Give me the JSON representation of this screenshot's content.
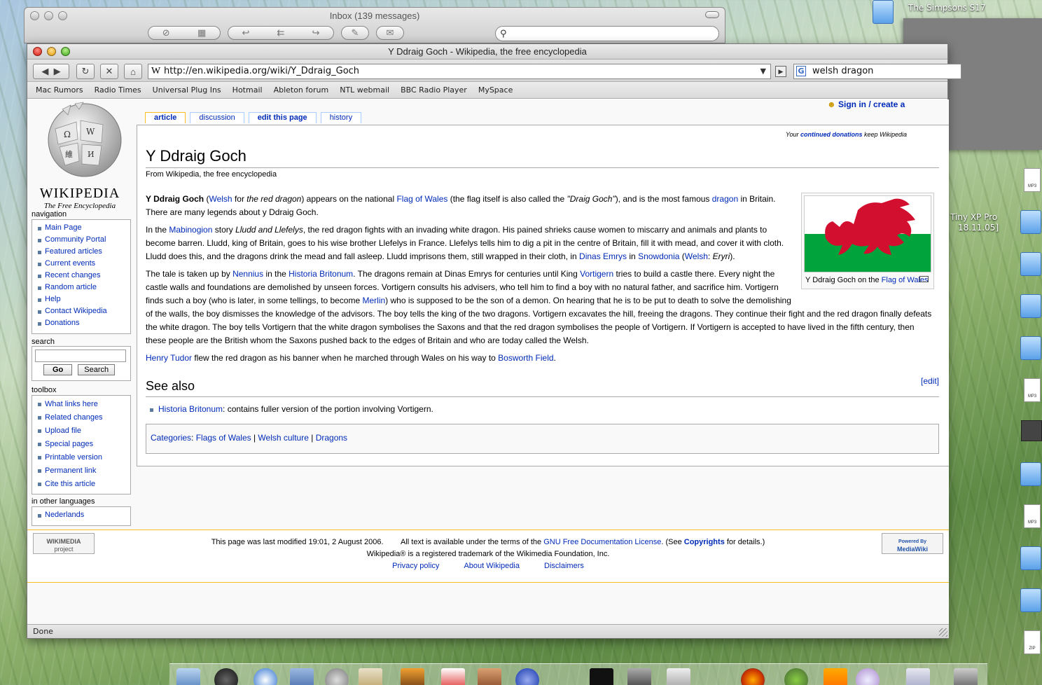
{
  "mail": {
    "title": "Inbox (139 messages)"
  },
  "browser": {
    "title": "Y Ddraig Goch - Wikipedia, the free encyclopedia",
    "url": "http://en.wikipedia.org/wiki/Y_Ddraig_Goch",
    "search_value": "welsh dragon",
    "bookmarks": [
      "Mac Rumors",
      "Radio Times",
      "Universal Plug Ins",
      "Hotmail",
      "Ableton forum",
      "NTL webmail",
      "BBC Radio Player",
      "MySpace"
    ],
    "status": "Done"
  },
  "wiki": {
    "logo_title": "WIKIPEDIA",
    "logo_subtitle": "The Free Encyclopedia",
    "personal": "Sign in / create a",
    "tabs": [
      "article",
      "discussion",
      "edit this page",
      "history"
    ],
    "navigation_label": "navigation",
    "navigation": [
      "Main Page",
      "Community Portal",
      "Featured articles",
      "Current events",
      "Recent changes",
      "Random article",
      "Help",
      "Contact Wikipedia",
      "Donations"
    ],
    "search_label": "search",
    "search_go": "Go",
    "search_btn": "Search",
    "toolbox_label": "toolbox",
    "toolbox": [
      "What links here",
      "Related changes",
      "Upload file",
      "Special pages",
      "Printable version",
      "Permanent link",
      "Cite this article"
    ],
    "languages_label": "in other languages",
    "languages": [
      "Nederlands"
    ],
    "donate_pre": "Your ",
    "donate_link": "continued donations",
    "donate_post": " keep Wikipedia",
    "title": "Y Ddraig Goch",
    "from": "From Wikipedia, the free encyclopedia",
    "thumb_caption_pre": "Y Ddraig Goch on the ",
    "thumb_caption_link": "Flag of Wales",
    "edit": "[edit]",
    "see_also": "See also",
    "see_also_link": "Historia Britonum",
    "see_also_text": ": contains fuller version of the portion involving Vortigern.",
    "categories_label": "Categories",
    "categories": [
      "Flags of Wales",
      "Welsh culture",
      "Dragons"
    ],
    "footer_modified": "This page was last modified 19:01, 2 August 2006.",
    "footer_license_pre": "All text is available under the terms of the ",
    "footer_license_link": "GNU Free Documentation License",
    "footer_license_mid": ". (See ",
    "footer_license_link2": "Copyrights",
    "footer_license_post": " for details.)",
    "footer_trademark": "Wikipedia® is a registered trademark of the Wikimedia Foundation, Inc.",
    "footer_links": [
      "Privacy policy",
      "About Wikipedia",
      "Disclaimers"
    ],
    "wikimedia_logo": "WIKIMEDIA",
    "wikimedia_logo_sub": "project",
    "mediawiki_logo_top": "Powered By",
    "mediawiki_logo": "MediaWiki"
  },
  "desktop": {
    "label1": "The Simpsons S17",
    "label2": "Tiny XP Pro",
    "label3": "18.11.05]"
  },
  "colors": {
    "link": "#002bb8",
    "flag_red": "#d30f2f",
    "flag_green": "#00a33c"
  }
}
